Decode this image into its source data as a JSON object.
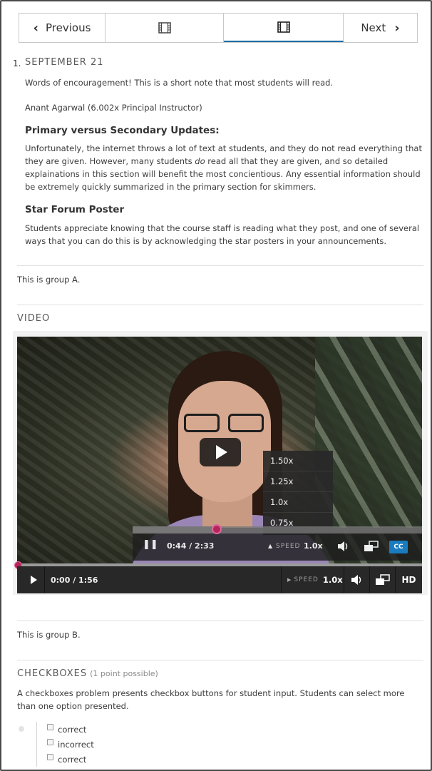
{
  "nav": {
    "previous_label": "Previous",
    "next_label": "Next",
    "seq_items": [
      {
        "icon": "video-icon",
        "active": false
      },
      {
        "icon": "video-icon",
        "active": true
      }
    ]
  },
  "announcement": {
    "number": "1.",
    "title": "SEPTEMBER 21",
    "intro": "Words of encouragement! This is a short note that most students will read.",
    "author": "Anant Agarwal (6.002x Principal Instructor)",
    "subheading_1": "Primary versus Secondary Updates:",
    "paragraph_1_part_a": "Unfortunately, the internet throws a lot of text at students, and they do not read everything that they are given. However, many students ",
    "paragraph_1_emphasis": "do",
    "paragraph_1_part_b": " read all that they are given, and so detailed explainations in this section will benefit the most concientious. Any essential information should be extremely quickly summarized in the primary section for skimmers.",
    "subheading_2": "Star Forum Poster",
    "paragraph_2": "Students appreciate knowing that the course staff is reading what they post, and one of several ways that you can do this is by acknowledging the star posters in your announcements."
  },
  "group_a_text": "This is group A.",
  "video": {
    "heading": "VIDEO",
    "inner_player": {
      "time": "0:44 / 2:33",
      "speed_label": "SPEED",
      "speed_value": "1.0x",
      "speed_options": [
        "1.50x",
        "1.25x",
        "1.0x",
        "0.75x"
      ],
      "cc_label": "CC",
      "progress_fraction": 0.29
    },
    "player": {
      "time": "0:00 / 1:56",
      "speed_label": "SPEED",
      "speed_value": "1.0x",
      "hd_label": "HD",
      "progress_fraction": 0.0
    }
  },
  "group_b_text": "This is group B.",
  "problem": {
    "heading": "CHECKBOXES",
    "points": "(1 point possible)",
    "description": "A checkboxes problem presents checkbox buttons for student input. Students can select more than one option presented.",
    "choices": [
      {
        "label": "correct"
      },
      {
        "label": "incorrect"
      },
      {
        "label": "correct"
      }
    ]
  }
}
